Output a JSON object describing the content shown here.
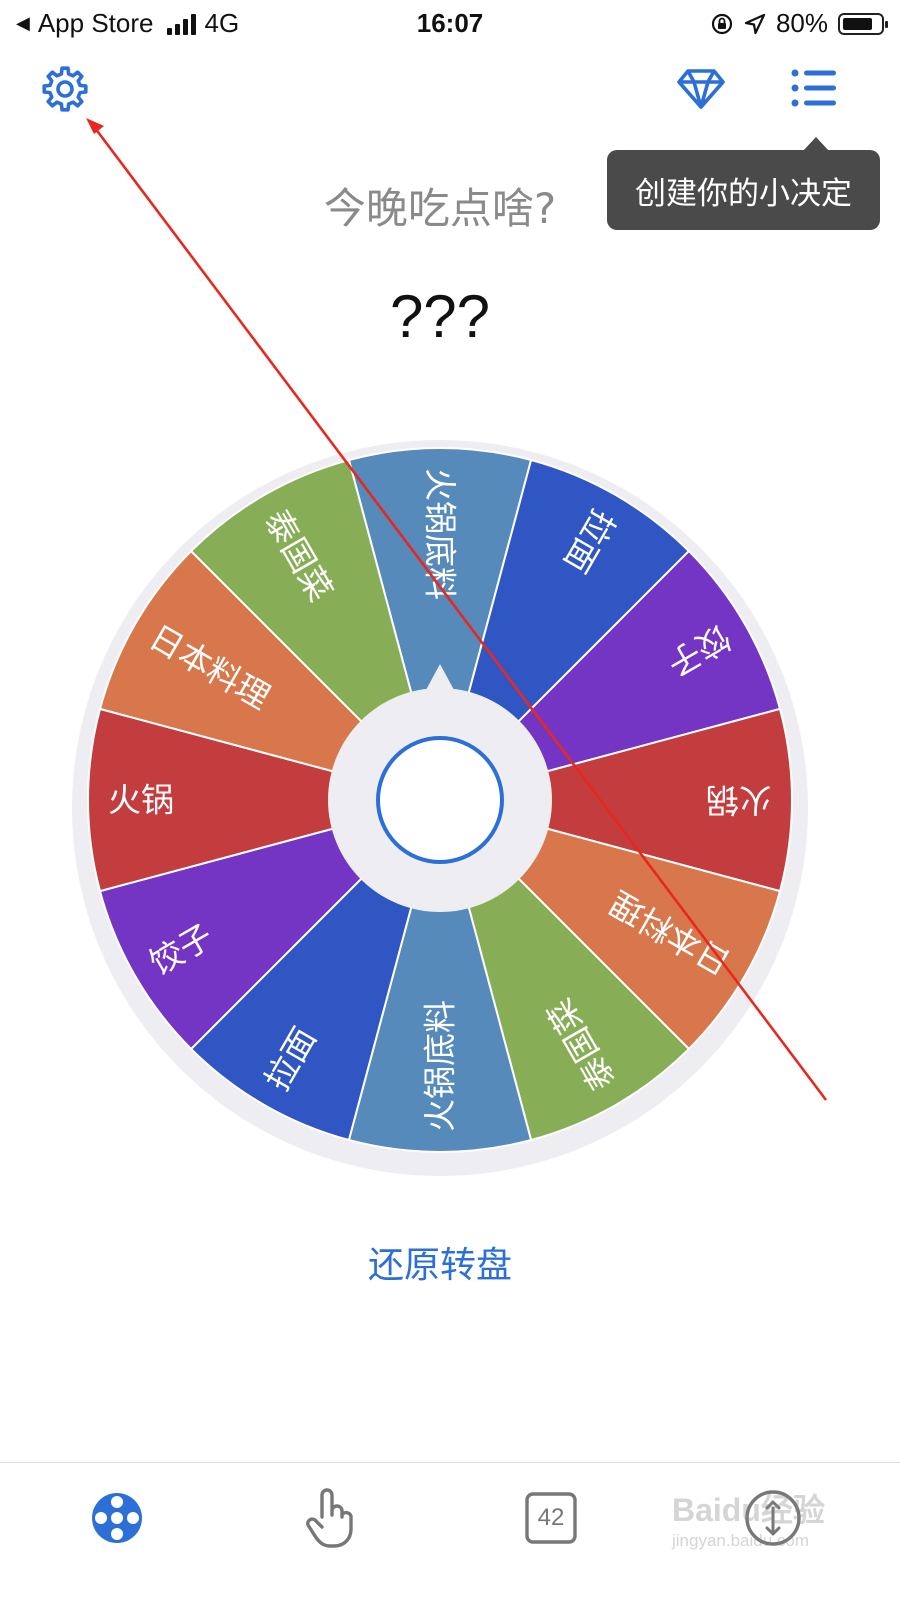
{
  "status_bar": {
    "back_label": "App Store",
    "network": "4G",
    "time": "16:07",
    "battery_percent": "80%",
    "battery_level": 0.8
  },
  "header": {
    "settings_icon": "gear-icon",
    "premium_icon": "diamond-icon",
    "list_icon": "list-icon",
    "tooltip": "创建你的小决定"
  },
  "main": {
    "question": "今晚吃点啥?",
    "result": "???",
    "restore_label": "还原转盘"
  },
  "wheel": {
    "segments": [
      {
        "label": "火锅底料",
        "color": "#558abb"
      },
      {
        "label": "拉面",
        "color": "#2f56c3"
      },
      {
        "label": "饺子",
        "color": "#7434c4"
      },
      {
        "label": "火锅",
        "color": "#c33d3f"
      },
      {
        "label": "日本料理",
        "color": "#d8774b"
      },
      {
        "label": "泰国菜",
        "color": "#88ad57"
      },
      {
        "label": "火锅底料",
        "color": "#558abb"
      },
      {
        "label": "拉面",
        "color": "#2f56c3"
      },
      {
        "label": "饺子",
        "color": "#7434c4"
      },
      {
        "label": "火锅",
        "color": "#c33d3f"
      },
      {
        "label": "日本料理",
        "color": "#d8774b"
      },
      {
        "label": "泰国菜",
        "color": "#88ad57"
      }
    ]
  },
  "tabs": [
    {
      "icon": "wheel-icon",
      "active": true
    },
    {
      "icon": "tap-hand-icon",
      "active": false
    },
    {
      "icon": "number-die-icon",
      "badge": "42",
      "active": false
    },
    {
      "icon": "coin-flip-icon",
      "active": false
    }
  ],
  "watermark": {
    "line1": "Baidu经验",
    "line2": "jingyan.baidu.com"
  },
  "colors": {
    "accent": "#2c6fd6",
    "tooltip_bg": "#4a4a4a"
  }
}
